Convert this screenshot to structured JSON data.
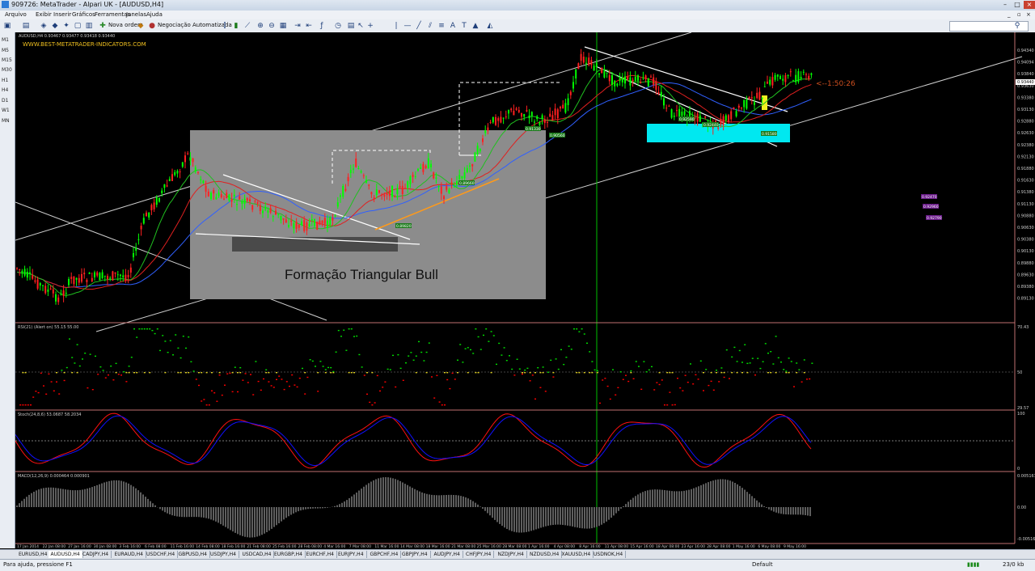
{
  "app": {
    "window_title": "909726: MetaTrader - Alpari UK - [AUDUSD,H4]"
  },
  "menu": [
    "Arquivo",
    "Exibir",
    "Inserir",
    "Gráficos",
    "Ferramentas",
    "Janelas",
    "Ajuda"
  ],
  "toolbar": {
    "new_order": "Nova ordem",
    "auto_trading": "Negociação Automatizada"
  },
  "timeframes": [
    "M1",
    "M5",
    "M15",
    "M30",
    "H1",
    "H4",
    "D1",
    "W1",
    "MN"
  ],
  "chart": {
    "info_line": "AUDUSD,H4  0.93467 0.93477 0.93418 0.93440",
    "website": "WWW.BEST-METATRADER-INDICATORS.COM",
    "overlay_label": "Formação Triangular Bull",
    "countdown": "<--1:50:26",
    "price_labels": [
      "0.94340",
      "0.94094",
      "0.93840",
      "0.93630",
      "0.93380",
      "0.93130",
      "0.92880",
      "0.92630",
      "0.92380",
      "0.92130",
      "0.91880",
      "0.91630",
      "0.91380",
      "0.91130",
      "0.90880",
      "0.90630",
      "0.90380",
      "0.90130",
      "0.89880",
      "0.89630",
      "0.89380",
      "0.89130"
    ],
    "current_price": "0.93440",
    "marker_labels": [
      "0.89820",
      "0.89660",
      "0.90560",
      "0.92470",
      "0.92960",
      "0.92790",
      "0.92590",
      "0.92440",
      "0.91580",
      "0.91330"
    ],
    "time_labels": [
      "17 Jan 2014",
      "22 Jan 08:00",
      "27 Jan 16:00",
      "30 Jan 08:00",
      "3 Feb 16:00",
      "6 Feb 08:00",
      "11 Feb 16:00",
      "14 Feb 08:00",
      "18 Feb 16:00",
      "21 Feb 08:00",
      "25 Feb 16:00",
      "28 Feb 08:00",
      "4 Mar 16:00",
      "7 Mar 08:00",
      "11 Mar 16:00",
      "14 Mar 08:00",
      "18 Mar 16:00",
      "21 Mar 08:00",
      "25 Mar 16:00",
      "28 Mar 08:00",
      "1 Apr 16:00",
      "4 Apr 08:00",
      "8 Apr 16:00",
      "11 Apr 08:00",
      "15 Apr 16:00",
      "18 Apr 08:00",
      "23 Apr 16:00",
      "28 Apr 08:00",
      "1 May 16:00",
      "6 May 08:00",
      "9 May 16:00"
    ]
  },
  "indicators": {
    "rsi": {
      "label": "RSI(21) (Alert on) 55.15 55.00",
      "levels": [
        "70.43",
        "29.57"
      ],
      "mid": "50"
    },
    "stoch": {
      "label": "Stoch(24,8,6) 53.0687 58.2034",
      "levels": [
        "100",
        "0"
      ]
    },
    "macd": {
      "label": "MACD(12,26,9) 0.000464 0.000901",
      "levels": [
        "0.005167",
        "0.00",
        "-0.005167"
      ]
    }
  },
  "tabs": [
    "EURUSD,H4",
    "AUDUSD,H4",
    "CADJPY,H4",
    "EURAUD,H4",
    "USDCHF,H4",
    "GBPUSD,H4",
    "USDJPY,H4",
    "USDCAD,H4",
    "EURGBP,H4",
    "EURCHF,H4",
    "EURJPY,H4",
    "GBPCHF,H4",
    "GBPJPY,H4",
    "AUDJPY,H4",
    "CHFJPY,H4",
    "NZDJPY,H4",
    "NZDUSD,H4",
    "XAUUSD,H4",
    "USDNOK,H4"
  ],
  "active_tab": 1,
  "status": {
    "help": "Para ajuda, pressione F1",
    "profile": "Default",
    "traffic": "23/0 kb"
  },
  "colors": {
    "bull_candle": "#00ff00",
    "bear_candle": "#ff2020",
    "rsi_up": "#00e000",
    "rsi_down": "#ff0000",
    "stoch_main": "#ff1010",
    "stoch_signal": "#1010ff",
    "overlay_gray": "#8c8c8c",
    "cyan_box": "#00e8f0",
    "vertical_line": "#00c000"
  }
}
